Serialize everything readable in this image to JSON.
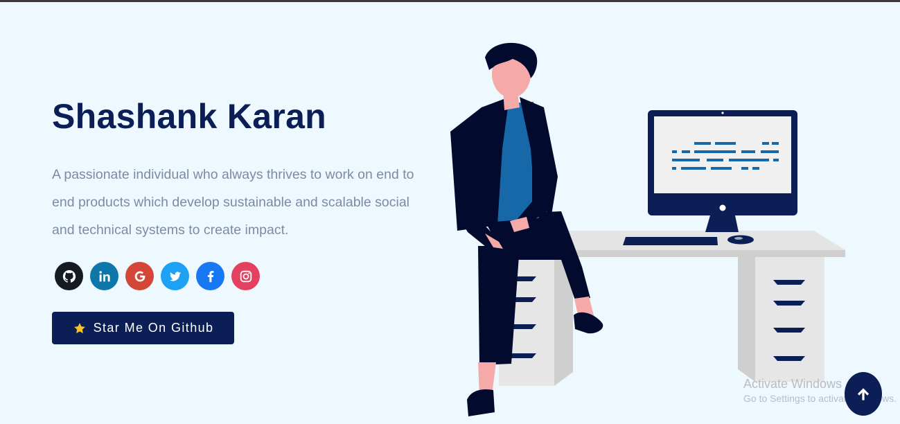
{
  "hero": {
    "name": "Shashank Karan",
    "bio": "A passionate individual who always thrives to work on end to end products which develop sustainable and scalable social and technical systems to create impact.",
    "button_label": "Star Me On Github"
  },
  "social_links": [
    {
      "name": "github-icon",
      "color": "#161b22"
    },
    {
      "name": "linkedin-icon",
      "color": "#0e76a8"
    },
    {
      "name": "google-icon",
      "color": "#d44638"
    },
    {
      "name": "twitter-icon",
      "color": "#1da1f2"
    },
    {
      "name": "facebook-icon",
      "color": "#1877f2"
    },
    {
      "name": "instagram-icon",
      "color": "#e4405f"
    }
  ],
  "watermark": {
    "title": "Activate Windows",
    "subtitle": "Go to Settings to activate Windows."
  },
  "colors": {
    "background": "#eef8ff",
    "primary": "#0b1e55",
    "text_muted": "#7d8aa3"
  }
}
